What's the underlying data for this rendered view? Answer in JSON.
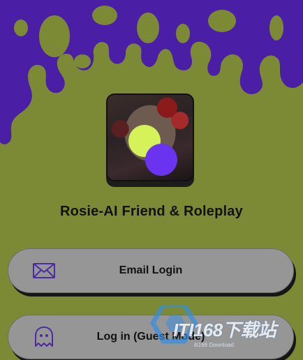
{
  "app": {
    "title": "Rosie-AI Friend & Roleplay"
  },
  "buttons": {
    "email_login_label": "Email Login",
    "guest_login_label": "Log in (Guest Mode)"
  },
  "watermark": {
    "text": "ITI168下载站",
    "subtext": "iti168 Download"
  },
  "colors": {
    "background": "#7d8a35",
    "splash": "#4a1fa6",
    "button": "#969696",
    "icon_purple": "#4b2aa3",
    "dot_yellow": "#d6f25a",
    "dot_purple": "#6a33f0"
  },
  "icons": {
    "email": "envelope-icon",
    "guest": "ghost-icon"
  }
}
